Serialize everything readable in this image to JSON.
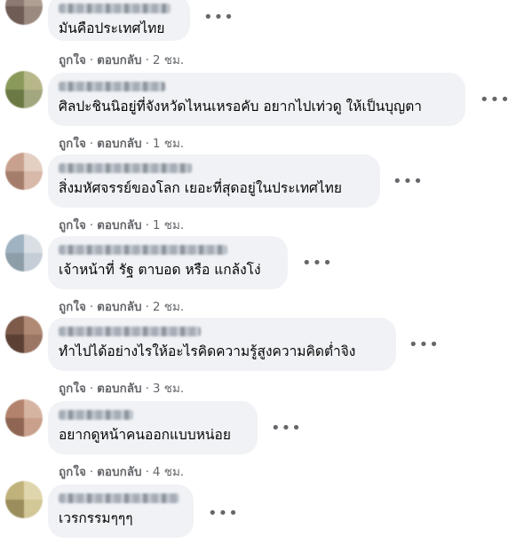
{
  "comments": [
    {
      "text": "มันคือประเทศไทย",
      "like": "ถูกใจ",
      "reply": "ตอบกลับ",
      "time": "2 ชม.",
      "avatar": [
        "#8d7a72",
        "#b0a094",
        "#6f5d55",
        "#9a8a80"
      ]
    },
    {
      "text": "ศิลปะชินนิอยู่ที่จังหวัดไหนเหรอคับ อยากไปเท่วดู ให้เป็นบุญตา",
      "like": "ถูกใจ",
      "reply": "ตอบกลับ",
      "time": "1 ชม.",
      "avatar": [
        "#8a9a5b",
        "#b8b78a",
        "#6b7a45",
        "#a3a780"
      ]
    },
    {
      "text": "สิ่งมหัศจรรย์ของโลก เยอะที่สุดอยู่ในประเทศไทย",
      "like": "ถูกใจ",
      "reply": "ตอบกลับ",
      "time": "1 ชม.",
      "avatar": [
        "#c9a08e",
        "#e4cfc3",
        "#a67c6a",
        "#d8b8a8"
      ]
    },
    {
      "text": "เจ้าหน้าที่ รัฐ ตาบอด หรือ แกล้งโง่",
      "like": "ถูกใจ",
      "reply": "ตอบกลับ",
      "time": "2 ชม.",
      "avatar": [
        "#9fb3c2",
        "#d9dfe4",
        "#8e9ea8",
        "#c5ced6"
      ]
    },
    {
      "text": "ทำไปได้อย่างไรให้อะไรคิดความรู้สูงความคิดต่ำจิง",
      "like": "ถูกใจ",
      "reply": "ตอบกลับ",
      "time": "3 ชม.",
      "avatar": [
        "#7d5a4a",
        "#b08a74",
        "#5c4034",
        "#9c7664"
      ]
    },
    {
      "text": "อยากดูหน้าคนออกแบบหน่อย",
      "like": "ถูกใจ",
      "reply": "ตอบกลับ",
      "time": "4 ชม.",
      "avatar": [
        "#b4836e",
        "#d6b4a2",
        "#8f6553",
        "#c9a08c"
      ]
    },
    {
      "text": "เวรกรรมๆๆๆ",
      "like": "ถูกใจ",
      "reply": "ตอบกลับ",
      "time": "",
      "avatar": [
        "#c0b27a",
        "#e0d6ae",
        "#9c8e5c",
        "#d2c796"
      ]
    }
  ],
  "more_icon": "horizontal-ellipsis-icon",
  "colors": {
    "bubble": "#f0f2f5",
    "text": "#050505",
    "meta": "#65676b"
  }
}
